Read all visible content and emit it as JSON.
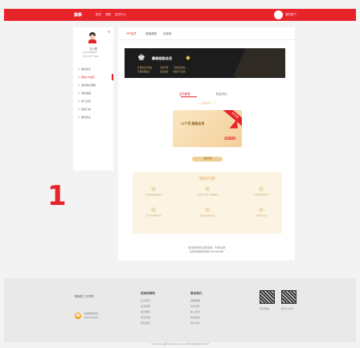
{
  "topbar": {
    "logo": "秦枫",
    "nav": [
      "首页",
      "课程",
      "会员中心"
    ],
    "user_name": "我的账户"
  },
  "sidebar": {
    "name": "王小琪",
    "lines": [
      "ID 1004598210",
      "手机 138****6321"
    ],
    "menu": [
      {
        "label": "我的信息",
        "active": false
      },
      {
        "label": "我的VIP会员",
        "active": true
      },
      {
        "label": "我的购买课程",
        "active": false
      },
      {
        "label": "我的收藏",
        "active": false
      },
      {
        "label": "学习记录",
        "active": false
      },
      {
        "label": "我的订单",
        "active": false
      },
      {
        "label": "账号安全",
        "active": false
      }
    ]
  },
  "main": {
    "tabs": [
      "VIP会员",
      "直播课程",
      "优惠券"
    ],
    "banner": {
      "title": "秦枫超级会员",
      "rows": [
        [
          "开通会员享特权",
          "立即开通",
          "了解会员特权"
        ],
        [
          "开通超级会员",
          "会员权益",
          "专属学习通道"
        ]
      ]
    },
    "sub_tabs": [
      "会员套餐",
      "权益对比"
    ],
    "privilege_title": "—— 超级会员 ——",
    "card": {
      "name": "12个月 超级会员",
      "price": "¥3899",
      "ribbon": "限时特惠"
    },
    "buy_button": "立即开通",
    "benefits_title": "特权内容",
    "benefits": [
      "专享精品课程免费学",
      "专属学习计划与答疑服务",
      "专享课程优惠折扣",
      "专享学习资料下载",
      "专属会员身份标识",
      "专享线下活动"
    ],
    "notes": [
      "*会员服务购买后即刻生效，不支持退款",
      "如有问题请联系客服 4008-828-888"
    ]
  },
  "annotation_number": "1",
  "footer": {
    "brand": "秦枫职工作学院",
    "phone_label": "全国服务热线",
    "phone": "4008-828-888",
    "col1_title": "使用和帮助",
    "col1_items": [
      "关于我们",
      "新手指南",
      "会员服务",
      "常见问题",
      "联系我们"
    ],
    "col2_title": "联系我们",
    "col2_items": [
      "客服邮箱",
      "商务合作",
      "加入我们",
      "投诉建议",
      "用户协议"
    ],
    "qr_labels": [
      "官方微信",
      "官方公众号"
    ],
    "copyright": "©2016-2021 秦枫 All Rights Reserved | 浙ICP备2020000000号"
  }
}
